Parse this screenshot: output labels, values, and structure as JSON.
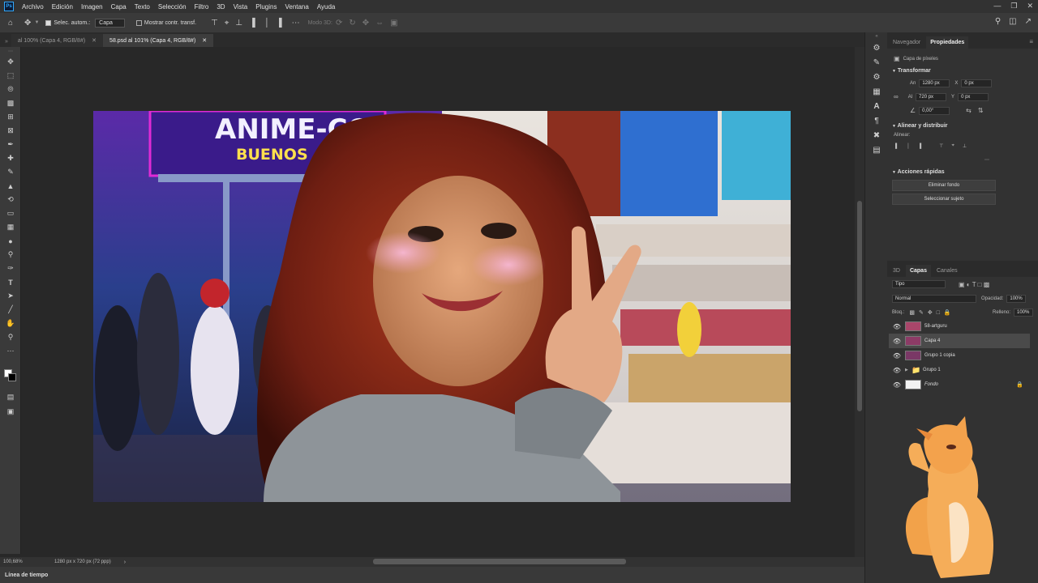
{
  "menubar": {
    "logo": "Ps",
    "items": [
      "Archivo",
      "Edición",
      "Imagen",
      "Capa",
      "Texto",
      "Selección",
      "Filtro",
      "3D",
      "Vista",
      "Plugins",
      "Ventana",
      "Ayuda"
    ]
  },
  "options": {
    "auto_select_label": "Selec. autom.:",
    "auto_select_value": "Capa",
    "show_transform_label": "Mostrar contr. transf.",
    "mode3d_label": "Modo 3D:"
  },
  "tabs": [
    {
      "label": "al 100% (Capa 4, RGB/8#)",
      "active": false
    },
    {
      "label": "58.psd al 101% (Capa 4, RGB/8#)",
      "active": true
    }
  ],
  "status": {
    "zoom": "100,68%",
    "doc_size": "1280 px x 720 px (72 ppp)"
  },
  "timeline": {
    "label": "Línea de tiempo"
  },
  "properties": {
    "tabs": [
      "Navegador",
      "Propiedades"
    ],
    "layer_type": "Capa de píxeles",
    "transform_title": "Transformar",
    "an_label": "An",
    "an_value": "1280 px",
    "x_label": "X",
    "x_value": "0 px",
    "al_label": "Al",
    "al_value": "720 px",
    "y_label": "Y",
    "y_value": "0 px",
    "angle_value": "0,00°",
    "align_title": "Alinear y distribuir",
    "align_label": "Alinear:",
    "quick_title": "Acciones rápidas",
    "remove_bg": "Eliminar fondo",
    "select_subject": "Seleccionar sujeto"
  },
  "layers_panel": {
    "tabs": [
      "3D",
      "Capas",
      "Canales"
    ],
    "filter": "Tipo",
    "blend_mode": "Normal",
    "opacity_label": "Opacidad:",
    "opacity_value": "100%",
    "lock_label": "Bloq.:",
    "fill_label": "Relleno:",
    "fill_value": "100%",
    "layers": [
      {
        "name": "58-artguru",
        "selected": false
      },
      {
        "name": "Capa 4",
        "selected": true
      },
      {
        "name": "Grupo 1 copia",
        "selected": false
      },
      {
        "name": "Grupo 1",
        "selected": false
      },
      {
        "name": "Fondo",
        "selected": false
      }
    ]
  },
  "artwork": {
    "banner_line1": "ANIME-CON",
    "banner_line2": "BUENOS AIRES"
  },
  "colors": {
    "accent": "#31a8ff",
    "panel": "#323232",
    "canvas_bg": "#282828"
  }
}
